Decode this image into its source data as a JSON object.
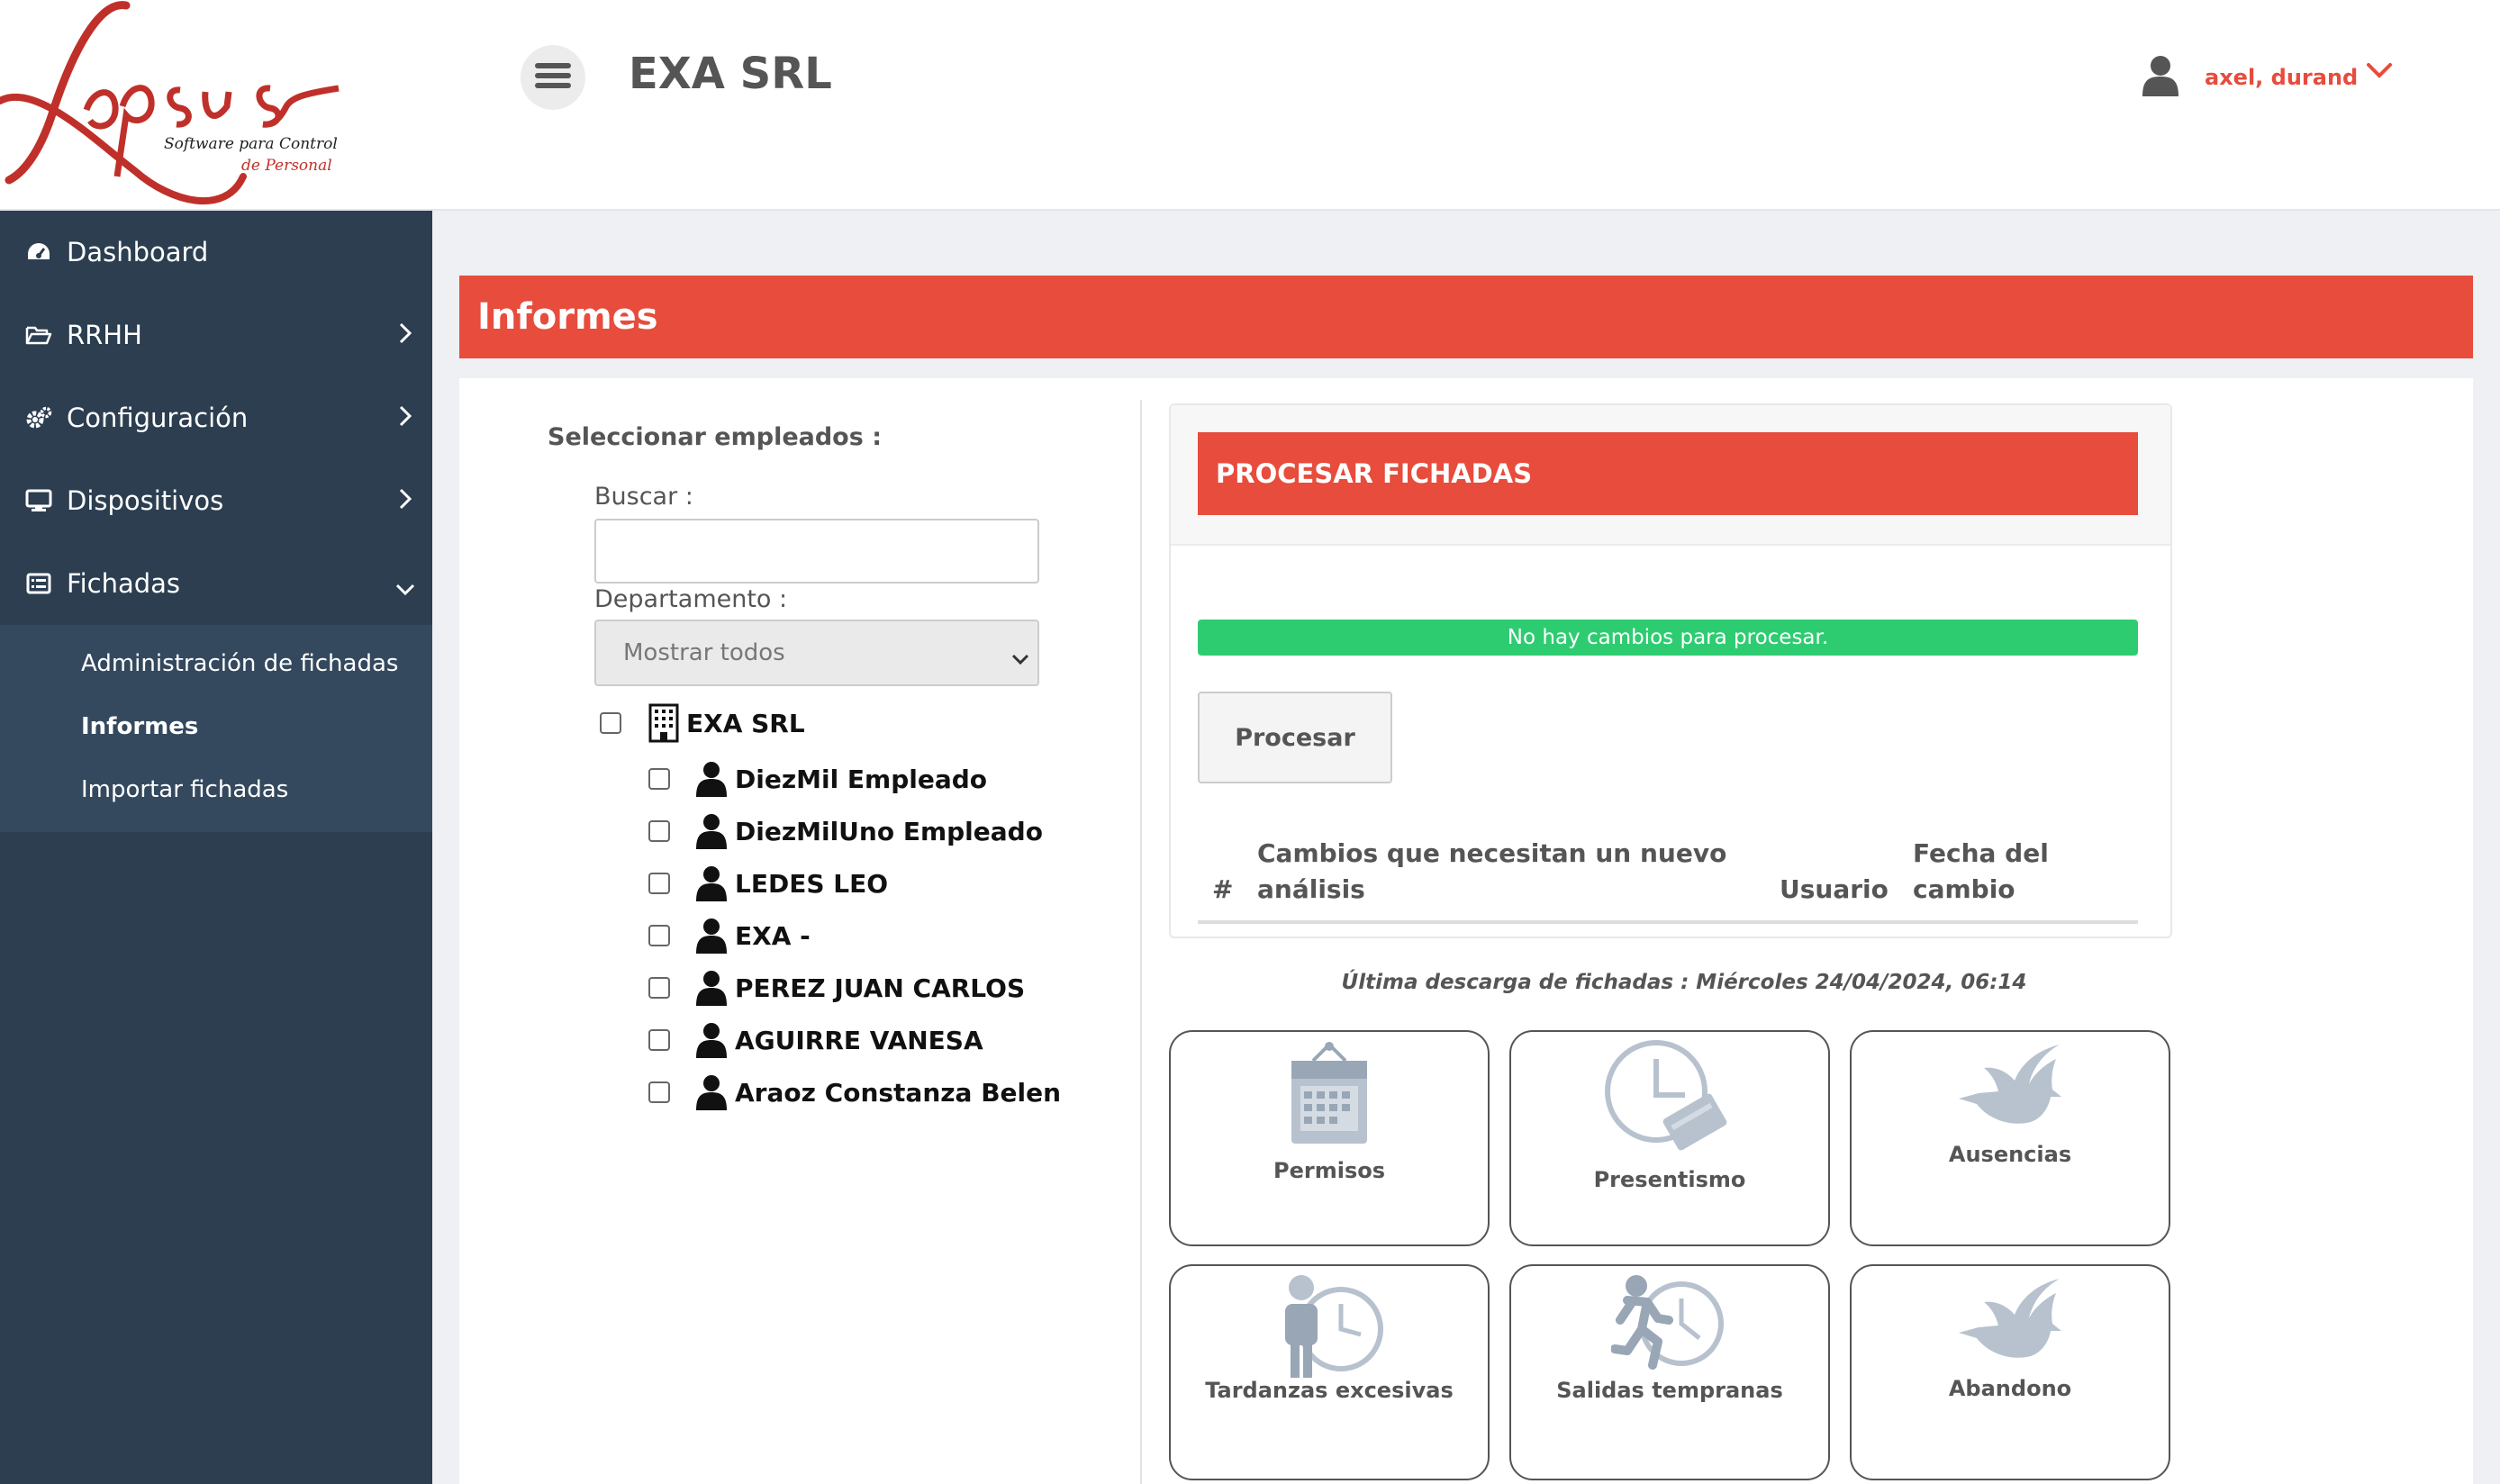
{
  "brand": {
    "logo_text": "Lapsus",
    "tagline_1": "Software para Control",
    "tagline_2": "de Personal",
    "accent": "#e74c3c"
  },
  "header": {
    "company": "EXA SRL",
    "user_name": "axel, durand",
    "menu_icon": "hamburger-icon",
    "user_icon": "user-icon"
  },
  "sidebar": {
    "items": [
      {
        "label": "Dashboard",
        "icon": "dashboard-icon"
      },
      {
        "label": "RRHH",
        "icon": "folder-open-icon"
      },
      {
        "label": "Configuración",
        "icon": "cogs-icon"
      },
      {
        "label": "Dispositivos",
        "icon": "desktop-icon"
      },
      {
        "label": "Fichadas",
        "icon": "list-alt-icon"
      }
    ],
    "submenu": [
      {
        "label": "Administración de fichadas"
      },
      {
        "label": "Informes"
      },
      {
        "label": "Importar fichadas"
      }
    ]
  },
  "page": {
    "title": "Informes"
  },
  "employees": {
    "select_label": "Seleccionar empleados :",
    "search_label": "Buscar :",
    "search_value": "",
    "dept_label": "Departamento :",
    "dept_selected": "Mostrar todos",
    "company_node": "EXA SRL",
    "list": [
      "DiezMil Empleado",
      "DiezMilUno Empleado",
      "LEDES LEO",
      "EXA -",
      "PEREZ JUAN CARLOS",
      "AGUIRRE VANESA",
      "Araoz Constanza Belen"
    ]
  },
  "process": {
    "title": "PROCESAR FICHADAS",
    "status": "No hay cambios para procesar.",
    "button": "Procesar",
    "col_num": "#",
    "col_changes_1": "Cambios que necesitan un nuevo",
    "col_changes_2": "análisis",
    "col_user": "Usuario",
    "col_date_1": "Fecha del",
    "col_date_2": "cambio",
    "status_color": "#2ecc71"
  },
  "last_download": "Última descarga de fichadas : Miércoles 24/04/2024, 06:14",
  "reports": [
    {
      "label": "Permisos",
      "icon": "calendar-icon"
    },
    {
      "label": "Presentismo",
      "icon": "clock-card-icon"
    },
    {
      "label": "Ausencias",
      "icon": "dove-icon"
    },
    {
      "label": "Tardanzas excesivas",
      "icon": "person-clock-icon"
    },
    {
      "label": "Salidas tempranas",
      "icon": "running-clock-icon"
    },
    {
      "label": "Abandono",
      "icon": "dove-icon"
    }
  ]
}
